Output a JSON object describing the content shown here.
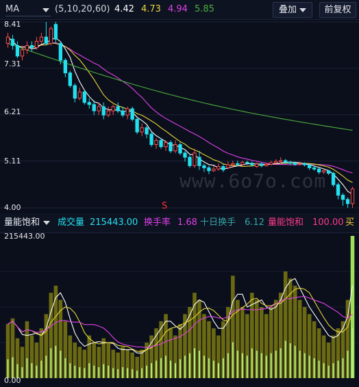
{
  "price_header": {
    "indicator": "MA",
    "params": "(5,10,20,60)",
    "ma5": "4.42",
    "ma10": "4.73",
    "ma20": "4.94",
    "ma60": "5.85",
    "overlay_label": "叠加",
    "adjust_label": "前复权"
  },
  "price_axis": {
    "top": "8.41",
    "l2": "7.31",
    "l3": "6.21",
    "l4": "5.11",
    "bottom": "4.00"
  },
  "signal_marker": "S",
  "watermark": "www.6o7o.com",
  "volume_header": {
    "indicator": "量能饱和",
    "vol_label": "成交量",
    "vol_value": "215443.00",
    "turnover_label": "换手率",
    "turnover_value": "1.68",
    "ten_day_label": "十日换手",
    "ten_day_value": "6.12",
    "sat_label": "量能饱和",
    "sat_value": "100.00",
    "buy_label": "买"
  },
  "volume_axis": {
    "top": "215443.00",
    "bottom": "0.00"
  },
  "colors": {
    "up": "#ff4d4d",
    "down": "#22e0ee",
    "ma5": "#ffffff",
    "ma10": "#e8d63a",
    "ma20": "#e040e8",
    "ma60": "#4caf3c",
    "vol_bar": "#6b6a12",
    "vol_hi": "#b8f07a"
  },
  "chart_data": {
    "type": "candlestick",
    "ylim": [
      4.0,
      8.41
    ],
    "candles": [
      [
        7.9,
        8.05,
        8.15,
        7.8
      ],
      [
        8.0,
        7.85,
        8.1,
        7.75
      ],
      [
        7.85,
        7.6,
        7.95,
        7.55
      ],
      [
        7.6,
        7.75,
        7.85,
        7.5
      ],
      [
        7.75,
        7.85,
        7.95,
        7.65
      ],
      [
        7.85,
        7.8,
        7.95,
        7.7
      ],
      [
        7.8,
        7.95,
        8.05,
        7.75
      ],
      [
        7.95,
        8.05,
        8.15,
        7.9
      ],
      [
        8.05,
        7.9,
        8.41,
        7.85
      ],
      [
        7.9,
        8.25,
        8.3,
        7.85
      ],
      [
        8.35,
        8.0,
        8.41,
        7.9
      ],
      [
        7.9,
        7.5,
        7.95,
        7.4
      ],
      [
        7.5,
        7.2,
        7.55,
        7.1
      ],
      [
        7.2,
        6.9,
        7.25,
        6.85
      ],
      [
        6.9,
        6.6,
        6.95,
        6.5
      ],
      [
        6.6,
        6.75,
        6.85,
        6.55
      ],
      [
        6.75,
        6.5,
        6.8,
        6.45
      ],
      [
        6.5,
        6.45,
        6.6,
        6.35
      ],
      [
        6.45,
        6.3,
        6.55,
        6.2
      ],
      [
        6.3,
        6.4,
        6.5,
        6.2
      ],
      [
        6.4,
        6.2,
        6.5,
        6.1
      ],
      [
        6.2,
        6.3,
        6.4,
        6.15
      ],
      [
        6.3,
        6.4,
        6.45,
        6.2
      ],
      [
        6.4,
        6.3,
        6.5,
        6.25
      ],
      [
        6.3,
        6.2,
        6.4,
        6.15
      ],
      [
        6.2,
        6.35,
        6.4,
        6.1
      ],
      [
        6.35,
        6.1,
        6.4,
        6.05
      ],
      [
        6.1,
        5.8,
        6.15,
        5.75
      ],
      [
        5.8,
        5.9,
        6.0,
        5.7
      ],
      [
        5.9,
        5.75,
        5.95,
        5.65
      ],
      [
        5.75,
        5.5,
        5.8,
        5.45
      ],
      [
        5.5,
        5.6,
        5.65,
        5.4
      ],
      [
        5.6,
        5.45,
        5.65,
        5.4
      ],
      [
        5.45,
        5.55,
        5.6,
        5.35
      ],
      [
        5.55,
        5.35,
        5.6,
        5.3
      ],
      [
        5.35,
        5.5,
        5.6,
        5.3
      ],
      [
        5.5,
        5.3,
        5.55,
        5.25
      ],
      [
        5.3,
        5.2,
        5.35,
        5.1
      ],
      [
        5.2,
        5.0,
        5.25,
        4.95
      ],
      [
        5.0,
        5.3,
        5.4,
        4.95
      ],
      [
        5.2,
        5.0,
        5.35,
        4.9
      ],
      [
        5.0,
        4.95,
        5.05,
        4.85
      ],
      [
        4.95,
        4.88,
        5.0,
        4.8
      ],
      [
        4.88,
        4.92,
        5.0,
        4.85
      ],
      [
        4.92,
        4.98,
        5.05,
        4.88
      ],
      [
        4.98,
        4.9,
        5.05,
        4.85
      ],
      [
        4.95,
        5.02,
        5.1,
        4.92
      ],
      [
        5.02,
        5.05,
        5.12,
        4.95
      ],
      [
        5.05,
        5.03,
        5.12,
        4.98
      ],
      [
        5.03,
        5.08,
        5.12,
        5.0
      ],
      [
        5.08,
        5.06,
        5.12,
        5.02
      ],
      [
        5.06,
        5.02,
        5.1,
        4.98
      ],
      [
        4.98,
        5.04,
        5.08,
        4.95
      ],
      [
        5.04,
        5.0,
        5.08,
        4.96
      ],
      [
        5.0,
        5.03,
        5.07,
        4.98
      ],
      [
        5.03,
        5.07,
        5.12,
        5.0
      ],
      [
        5.07,
        5.1,
        5.15,
        5.03
      ],
      [
        5.1,
        5.12,
        5.2,
        5.05
      ],
      [
        5.12,
        5.08,
        5.16,
        5.04
      ],
      [
        5.08,
        5.06,
        5.12,
        5.02
      ],
      [
        5.06,
        5.03,
        5.1,
        5.0
      ],
      [
        5.03,
        5.05,
        5.09,
        5.0
      ],
      [
        5.05,
        5.02,
        5.08,
        4.98
      ],
      [
        5.02,
        4.95,
        5.05,
        4.9
      ],
      [
        4.95,
        4.92,
        5.0,
        4.88
      ],
      [
        4.92,
        4.85,
        4.95,
        4.8
      ],
      [
        4.85,
        4.88,
        4.92,
        4.8
      ],
      [
        4.88,
        4.82,
        4.9,
        4.78
      ],
      [
        4.82,
        4.55,
        4.85,
        4.5
      ],
      [
        4.55,
        4.3,
        4.6,
        4.2
      ],
      [
        4.3,
        4.2,
        4.35,
        4.05
      ],
      [
        4.2,
        4.1,
        4.25,
        4.0
      ],
      [
        4.1,
        4.45,
        4.5,
        4.0
      ]
    ],
    "volumes": [
      0.38,
      0.42,
      0.28,
      0.22,
      0.4,
      0.3,
      0.25,
      0.35,
      0.45,
      0.6,
      0.65,
      0.55,
      0.4,
      0.3,
      0.25,
      0.22,
      0.2,
      0.3,
      0.25,
      0.22,
      0.28,
      0.25,
      0.2,
      0.18,
      0.22,
      0.2,
      0.18,
      0.15,
      0.2,
      0.25,
      0.3,
      0.35,
      0.4,
      0.45,
      0.35,
      0.3,
      0.38,
      0.45,
      0.5,
      0.6,
      0.55,
      0.45,
      0.4,
      0.35,
      0.3,
      0.4,
      0.5,
      0.72,
      0.55,
      0.5,
      0.45,
      0.6,
      0.55,
      0.5,
      0.45,
      0.5,
      0.55,
      0.6,
      0.75,
      0.7,
      0.65,
      0.55,
      0.5,
      0.45,
      0.4,
      0.35,
      0.3,
      0.25,
      0.3,
      0.35,
      0.4,
      0.55,
      1.0
    ]
  }
}
